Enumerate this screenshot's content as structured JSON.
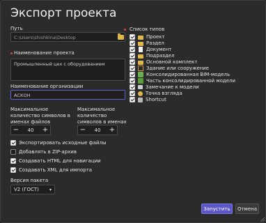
{
  "dialog": {
    "title": "Экспорт проекта"
  },
  "path": {
    "label": "Путь",
    "value": "C:\\Users\\shishkina\\Desktop"
  },
  "name": {
    "label": "Наименование проекта",
    "value": "Промышленный цех с оборудованием"
  },
  "organization": {
    "label": "Наименование организации",
    "value": "АСКОН"
  },
  "max_files": {
    "label": "Максимальное количество символов в именах файлов",
    "value": "40",
    "minus": "−",
    "plus": "+"
  },
  "max_folders": {
    "label": "Максимальное количество символов в именах папок",
    "value": "40",
    "minus": "−",
    "plus": "+"
  },
  "options": [
    {
      "label": "Экспортировать исходные файлы",
      "checked": true
    },
    {
      "label": "Добавлять в ZIP-архив",
      "checked": false
    },
    {
      "label": "Создавать HTML для навигации",
      "checked": true
    },
    {
      "label": "Создавать XML для импорта",
      "checked": true
    }
  ],
  "package_version": {
    "label": "Версия пакета",
    "value": "V2 (ГОСТ)"
  },
  "types": {
    "label": "Список типов",
    "items": [
      {
        "label": "Проект",
        "icon": "folder-icon"
      },
      {
        "label": "Раздел",
        "icon": "folder-icon"
      },
      {
        "label": "Документ",
        "icon": "document-icon"
      },
      {
        "label": "Подраздел",
        "icon": "folder-icon"
      },
      {
        "label": "Основной комплект",
        "icon": "folder-icon"
      },
      {
        "label": "Здание или сооружение",
        "icon": "building-icon"
      },
      {
        "label": "Консолидированная BIM-модель",
        "icon": "bim-model-icon"
      },
      {
        "label": "Часть консолидированной модели",
        "icon": "bim-part-icon"
      },
      {
        "label": "Замечание к модели",
        "icon": "remark-icon"
      },
      {
        "label": "Точка взгляда",
        "icon": "viewpoint-icon"
      },
      {
        "label": "Shortcut",
        "icon": "shortcut-icon"
      }
    ]
  },
  "footer": {
    "run_label": "Запустить",
    "cancel_label": "Отмена"
  },
  "colors": {
    "accent": "#5b57c9",
    "required": "#d64848",
    "background": "#2b2b2b"
  }
}
